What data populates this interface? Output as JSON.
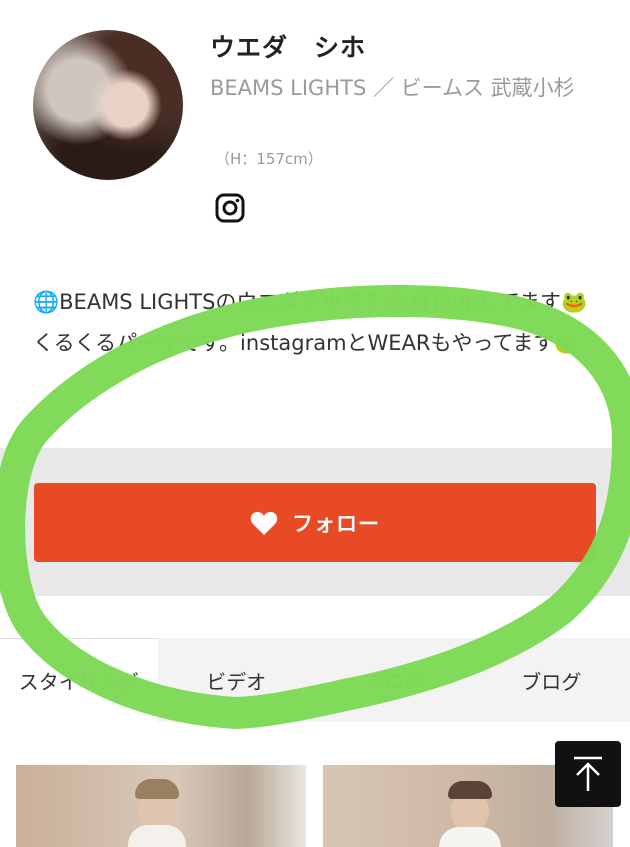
{
  "profile": {
    "name": "ウエダ　シホ",
    "shop": "BEAMS LIGHTS ／ ビームス 武蔵小杉",
    "height": "（H：157cm）",
    "bio": "🌐BEAMS LIGHTSのウエダシホです🔶毎日upしてます🐸くるくるパーマです。instagramとWEARもやってます🐸"
  },
  "social": {
    "icon": "instagram-icon"
  },
  "follow": {
    "label": "フォロー",
    "icon": "heart-icon",
    "color": "#e84a26"
  },
  "tabs": [
    {
      "label": "スタイリング",
      "active": true
    },
    {
      "label": "ビデオ",
      "active": false
    },
    {
      "label": "ブログ",
      "active": false
    },
    {
      "label": "ブログ",
      "active": false
    }
  ],
  "to_top": {
    "icon": "arrow-up-icon"
  },
  "annotation": {
    "color": "#7ed957"
  }
}
